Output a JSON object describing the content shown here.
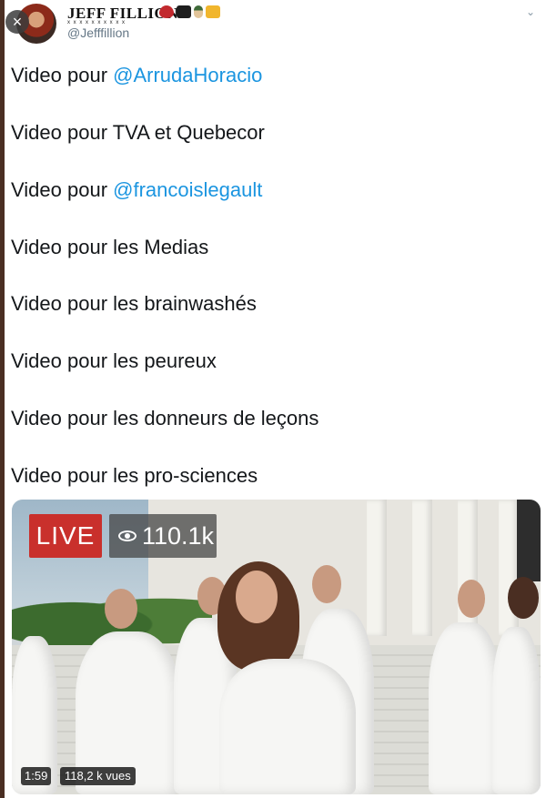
{
  "header": {
    "display_name": "JEFF FILLION",
    "name_decoration": "x x x x x x x x x x",
    "handle": "@Jefffillion",
    "emojis": [
      "lips-emoji",
      "pirate-flag-emoji",
      "golfer-emoji",
      "beer-mug-emoji"
    ],
    "close_icon": "×",
    "chevron_icon": "⌄"
  },
  "tweet": {
    "lines": [
      {
        "prefix": "Video pour ",
        "mention": "@ArrudaHoracio"
      },
      {
        "prefix": "Video pour TVA et Quebecor",
        "mention": ""
      },
      {
        "prefix": "Video pour ",
        "mention": "@francoislegault"
      },
      {
        "prefix": "Video pour les Medias",
        "mention": ""
      },
      {
        "prefix": "Video pour les brainwashés",
        "mention": ""
      },
      {
        "prefix": "Video pour les peureux",
        "mention": ""
      },
      {
        "prefix": "Video pour les donneurs de leçons",
        "mention": ""
      },
      {
        "prefix": "Video pour les pro-sciences",
        "mention": ""
      }
    ]
  },
  "media": {
    "live_label": "LIVE",
    "viewers": "110.1k",
    "duration": "1:59",
    "views": "118,2 k vues"
  },
  "colors": {
    "mention": "#1b95e0",
    "live_badge": "#c9302c",
    "handle": "#657786"
  }
}
